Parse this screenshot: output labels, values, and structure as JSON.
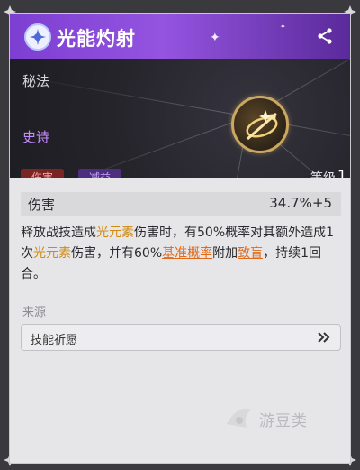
{
  "header": {
    "title": "光能灼射",
    "icon": "skill-type-emblem-icon",
    "share_icon": "share-icon"
  },
  "info": {
    "category": "秘法",
    "rarity": "史诗",
    "tags": [
      "伤害",
      "减益"
    ],
    "level_label": "等级",
    "level_value": "1"
  },
  "stat": {
    "name": "伤害",
    "value": "34.7%+5"
  },
  "description": {
    "p1": "释放战技造成",
    "k1": "光元素",
    "p2": "伤害时，有50%概率对其额外造成1次",
    "k2": "光元素",
    "p3": "伤害，并有60%",
    "k3": "基准概率",
    "p4": "附加",
    "k4": "致盲",
    "p5": "，持续1回合。"
  },
  "source": {
    "label": "来源",
    "value": "技能祈愿"
  },
  "watermark": {
    "text": "游豆类"
  },
  "colors": {
    "header": "#8a4bdc",
    "rarity": "#c58cff",
    "highlight_gold": "#d08a10",
    "highlight_orange": "#e06a1a",
    "tag_damage": "#7a2424",
    "tag_debuff": "#4c2d7e"
  }
}
